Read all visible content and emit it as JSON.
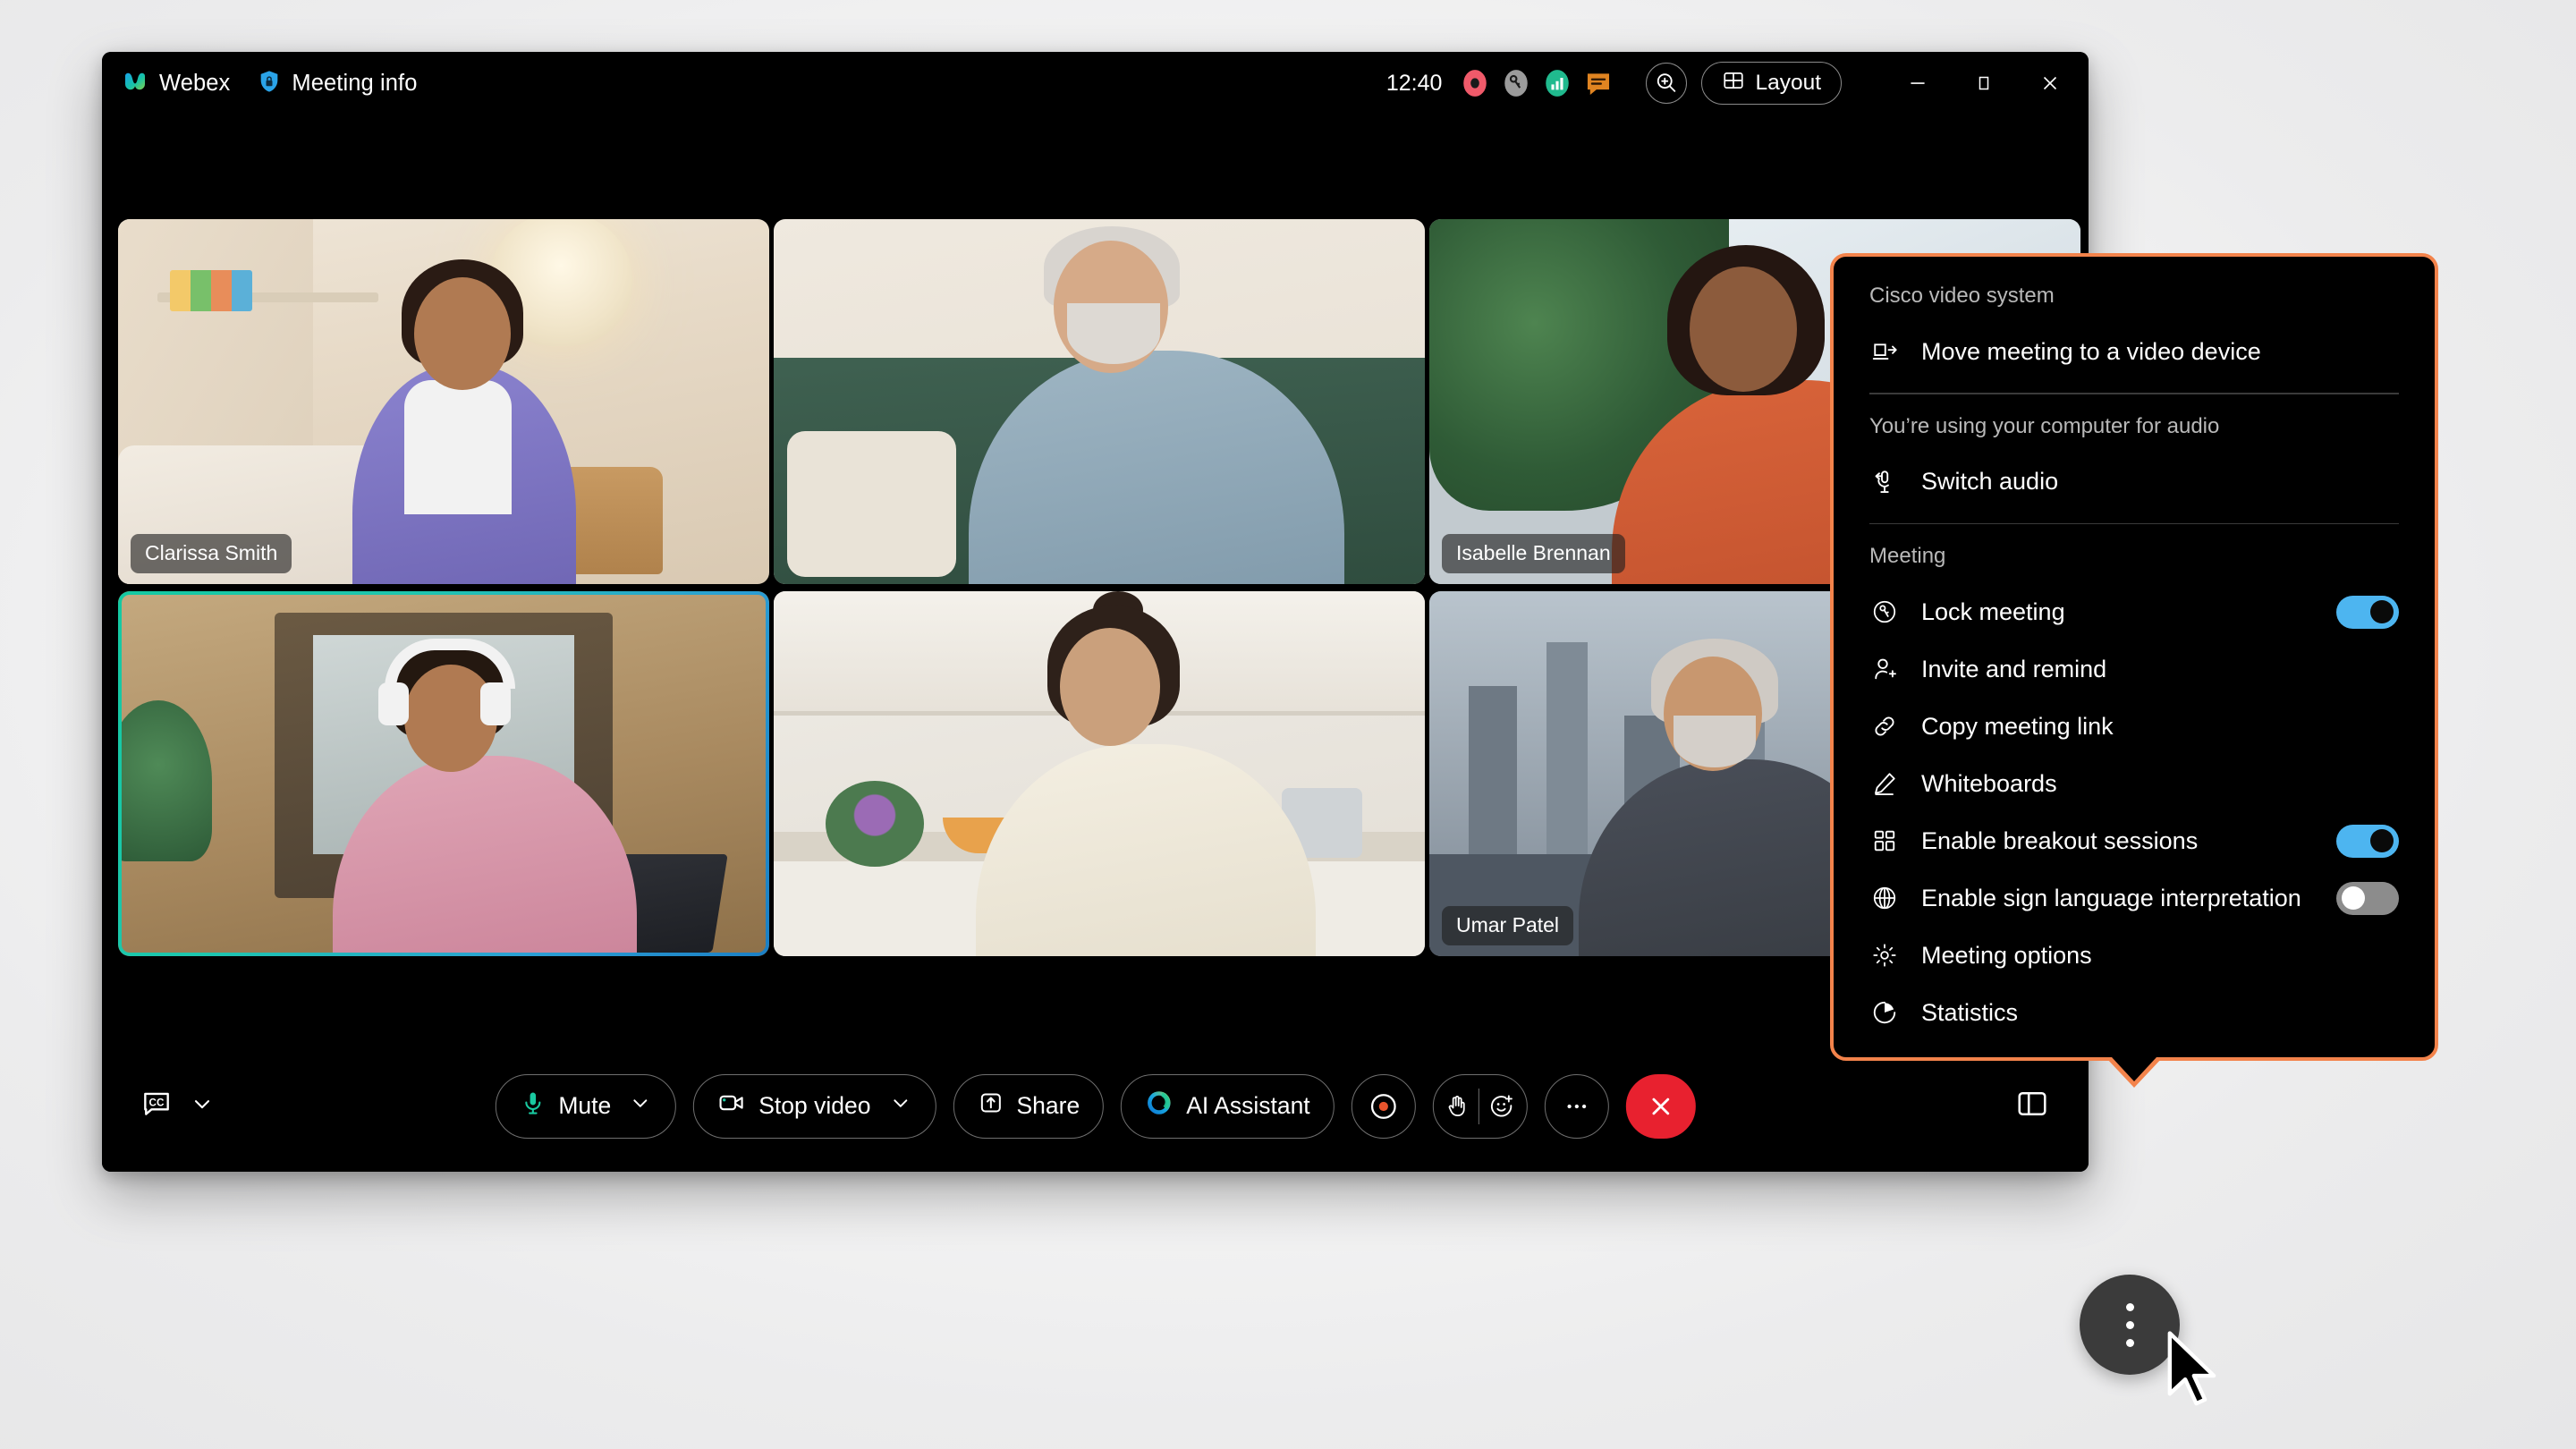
{
  "app": {
    "name": "Webex",
    "meeting_info_label": "Meeting info",
    "clock": "12:40",
    "layout_button": "Layout",
    "status_icons": [
      {
        "name": "recording-indicator-icon",
        "color": "#f05a6a"
      },
      {
        "name": "meeting-locked-key-icon",
        "color": "#9b9b9b"
      },
      {
        "name": "network-quality-icon",
        "color": "#20ba8e"
      },
      {
        "name": "chat-bubble-icon",
        "color": "#e08421"
      }
    ],
    "window_controls": {
      "minimize": "minimize-button",
      "maximize": "maximize-button",
      "close": "close-button"
    }
  },
  "stage": {
    "participants": [
      {
        "name": "Clarissa Smith",
        "show_name": true,
        "active_speaker": false
      },
      {
        "name": "",
        "show_name": false,
        "active_speaker": false
      },
      {
        "name": "Isabelle Brennan",
        "show_name": true,
        "active_speaker": false
      },
      {
        "name": "",
        "show_name": false,
        "active_speaker": true
      },
      {
        "name": "",
        "show_name": false,
        "active_speaker": false
      },
      {
        "name": "Umar Patel",
        "show_name": true,
        "active_speaker": false
      }
    ]
  },
  "controls": {
    "closed_captions": "cc-icon",
    "mute_label": "Mute",
    "stop_video_label": "Stop video",
    "share_label": "Share",
    "ai_assistant_label": "AI Assistant",
    "record_label": "record-button",
    "reactions_label": "reactions-button",
    "more_label": "more-options-button",
    "leave_label": "leave-meeting-button",
    "participants_label": "participants-button"
  },
  "popover": {
    "accent_color": "#f3834b",
    "sections": [
      {
        "title": "Cisco video system",
        "items": [
          {
            "label": "Move meeting to a video device",
            "icon": "move-to-device-icon",
            "toggle": null
          }
        ]
      },
      {
        "title": "You’re using your computer for audio",
        "items": [
          {
            "label": "Switch audio",
            "icon": "switch-audio-icon",
            "toggle": null
          }
        ]
      },
      {
        "title": "Meeting",
        "items": [
          {
            "label": "Lock meeting",
            "icon": "lock-key-icon",
            "toggle": "on"
          },
          {
            "label": "Invite and remind",
            "icon": "invite-person-icon",
            "toggle": null
          },
          {
            "label": "Copy meeting link",
            "icon": "link-icon",
            "toggle": null
          },
          {
            "label": "Whiteboards",
            "icon": "pencil-icon",
            "toggle": null
          },
          {
            "label": "Enable breakout sessions",
            "icon": "grid-squares-icon",
            "toggle": "on"
          },
          {
            "label": "Enable sign language interpretation",
            "icon": "globe-icon",
            "toggle": "off"
          },
          {
            "label": "Meeting options",
            "icon": "gear-icon",
            "toggle": null
          },
          {
            "label": "Statistics",
            "icon": "statistics-pie-icon",
            "toggle": null
          }
        ]
      }
    ]
  }
}
